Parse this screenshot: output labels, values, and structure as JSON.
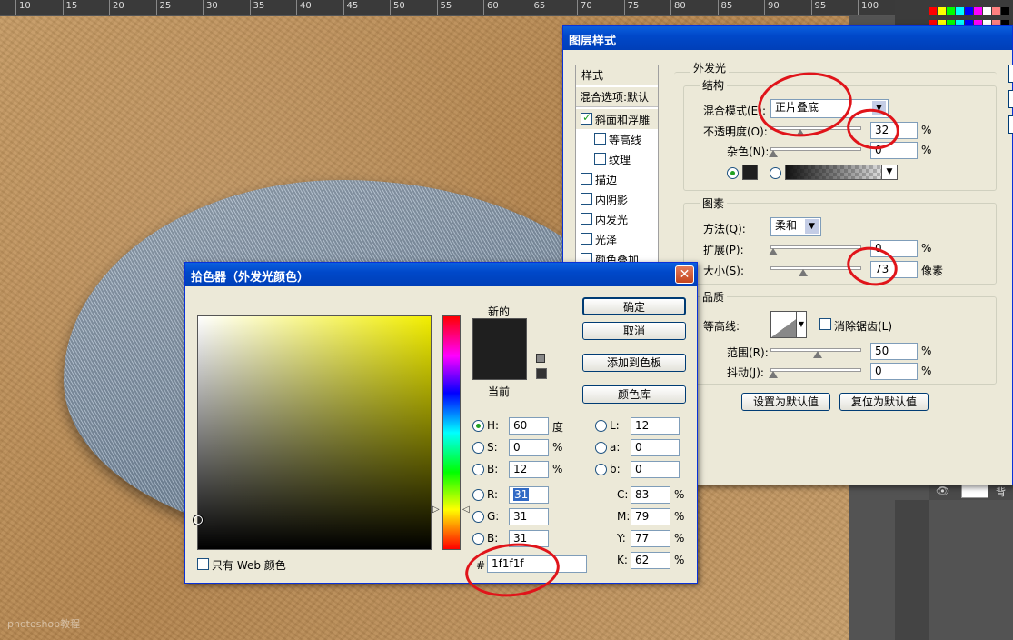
{
  "ruler": {
    "marks": [
      "10",
      "15",
      "20",
      "25",
      "30",
      "35",
      "40",
      "45",
      "50",
      "55",
      "60",
      "65",
      "70",
      "75",
      "80",
      "85",
      "90",
      "95",
      "100"
    ]
  },
  "watermark": "photoshop教程",
  "layers": {
    "name": "背"
  },
  "layer_style": {
    "title": "图层样式",
    "styles_header": "样式",
    "blend_default": "混合选项:默认",
    "style_items": [
      {
        "label": "斜面和浮雕",
        "checked": true
      },
      {
        "label": "等高线",
        "checked": false
      },
      {
        "label": "纹理",
        "checked": false
      },
      {
        "label": "描边",
        "checked": false
      },
      {
        "label": "内阴影",
        "checked": false
      },
      {
        "label": "内发光",
        "checked": false
      },
      {
        "label": "光泽",
        "checked": false
      },
      {
        "label": "颜色叠加",
        "checked": false
      }
    ],
    "section_title": "外发光",
    "structure": {
      "title": "结构",
      "blend_mode_label": "混合模式(E):",
      "blend_mode_value": "正片叠底",
      "opacity_label": "不透明度(O):",
      "opacity_value": "32",
      "noise_label": "杂色(N):",
      "noise_value": "0",
      "percent": "%"
    },
    "elements": {
      "title": "图素",
      "method_label": "方法(Q):",
      "method_value": "柔和",
      "spread_label": "扩展(P):",
      "spread_value": "0",
      "size_label": "大小(S):",
      "size_value": "73",
      "size_unit": "像素",
      "percent": "%"
    },
    "quality": {
      "title": "品质",
      "contour_label": "等高线:",
      "antialias_label": "消除锯齿(L)",
      "range_label": "范围(R):",
      "range_value": "50",
      "jitter_label": "抖动(J):",
      "jitter_value": "0",
      "percent": "%"
    },
    "make_default": "设置为默认值",
    "reset_default": "复位为默认值",
    "glow_color": "#1f1f1f"
  },
  "color_picker": {
    "title": "拾色器（外发光颜色）",
    "close": "✕",
    "new_label": "新的",
    "current_label": "当前",
    "ok": "确定",
    "cancel": "取消",
    "add_swatch": "添加到色板",
    "color_library": "颜色库",
    "hsb": [
      {
        "label": "H:",
        "value": "60",
        "unit": "度",
        "selected": true
      },
      {
        "label": "S:",
        "value": "0",
        "unit": "%",
        "selected": false
      },
      {
        "label": "B:",
        "value": "12",
        "unit": "%",
        "selected": false
      }
    ],
    "rgb": [
      {
        "label": "R:",
        "value": "31"
      },
      {
        "label": "G:",
        "value": "31"
      },
      {
        "label": "B:",
        "value": "31"
      }
    ],
    "lab": [
      {
        "label": "L:",
        "value": "12"
      },
      {
        "label": "a:",
        "value": "0"
      },
      {
        "label": "b:",
        "value": "0"
      }
    ],
    "cmyk": [
      {
        "label": "C:",
        "value": "83",
        "unit": "%"
      },
      {
        "label": "M:",
        "value": "79",
        "unit": "%"
      },
      {
        "label": "Y:",
        "value": "77",
        "unit": "%"
      },
      {
        "label": "K:",
        "value": "62",
        "unit": "%"
      }
    ],
    "hash": "#",
    "hex": "1f1f1f",
    "web_only": "只有 Web 颜色",
    "new_color": "#1f1f1f",
    "current_color": "#1f1f1f",
    "field_hue": "#f2ee00"
  }
}
